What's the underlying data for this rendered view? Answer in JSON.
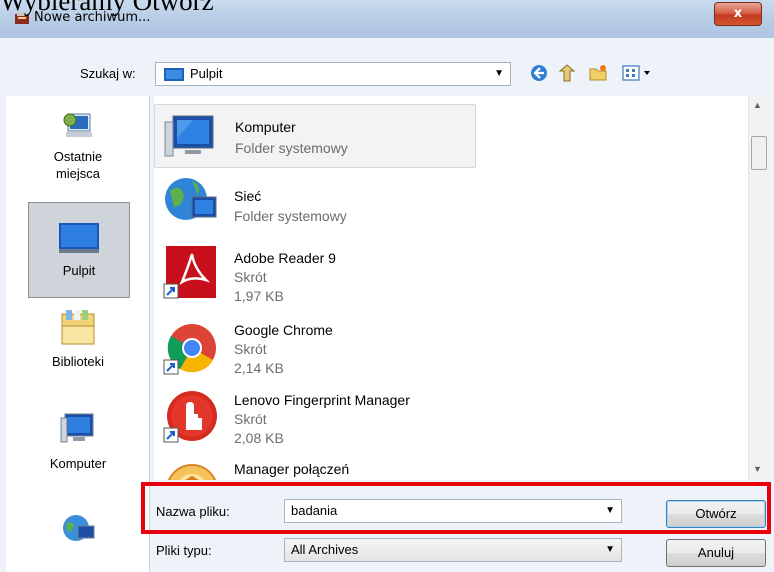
{
  "caption": "Wybieramy Otwórz",
  "window": {
    "title": "Nowe archiwum...",
    "close_glyph": "x"
  },
  "lookin": {
    "label": "Szukaj w:",
    "value": "Pulpit"
  },
  "toolbar": {
    "icons": [
      "back-icon",
      "up-folder-icon",
      "new-folder-icon",
      "view-menu-icon"
    ]
  },
  "places": [
    {
      "label": "Ostatnie\nmiejsca",
      "icon": "recent-places-icon",
      "selected": false
    },
    {
      "label": "Pulpit",
      "icon": "desktop-icon",
      "selected": true
    },
    {
      "label": "Biblioteki",
      "icon": "libraries-icon",
      "selected": false
    },
    {
      "label": "Komputer",
      "icon": "computer-icon",
      "selected": false
    },
    {
      "label": "",
      "icon": "network-icon",
      "selected": false
    }
  ],
  "files": [
    {
      "name": "Komputer",
      "type": "Folder systemowy",
      "size": "",
      "icon": "computer-icon"
    },
    {
      "name": "Sieć",
      "type": "Folder systemowy",
      "size": "",
      "icon": "network-icon"
    },
    {
      "name": "Adobe Reader 9",
      "type": "Skrót",
      "size": "1,97 KB",
      "icon": "adobe-reader-icon"
    },
    {
      "name": "Google Chrome",
      "type": "Skrót",
      "size": "2,14 KB",
      "icon": "chrome-icon"
    },
    {
      "name": "Lenovo Fingerprint Manager",
      "type": "Skrót",
      "size": "2,08 KB",
      "icon": "fingerprint-icon"
    },
    {
      "name": "Manager połączeń",
      "type": "",
      "size": "",
      "icon": "connection-manager-icon"
    }
  ],
  "filename": {
    "label": "Nazwa pliku:",
    "value": "badania"
  },
  "filetype": {
    "label": "Pliki typu:",
    "value": "All Archives"
  },
  "buttons": {
    "open": "Otwórz",
    "cancel": "Anuluj"
  },
  "colors": {
    "highlight": "#e8000d",
    "selection": "#cfd4da"
  }
}
